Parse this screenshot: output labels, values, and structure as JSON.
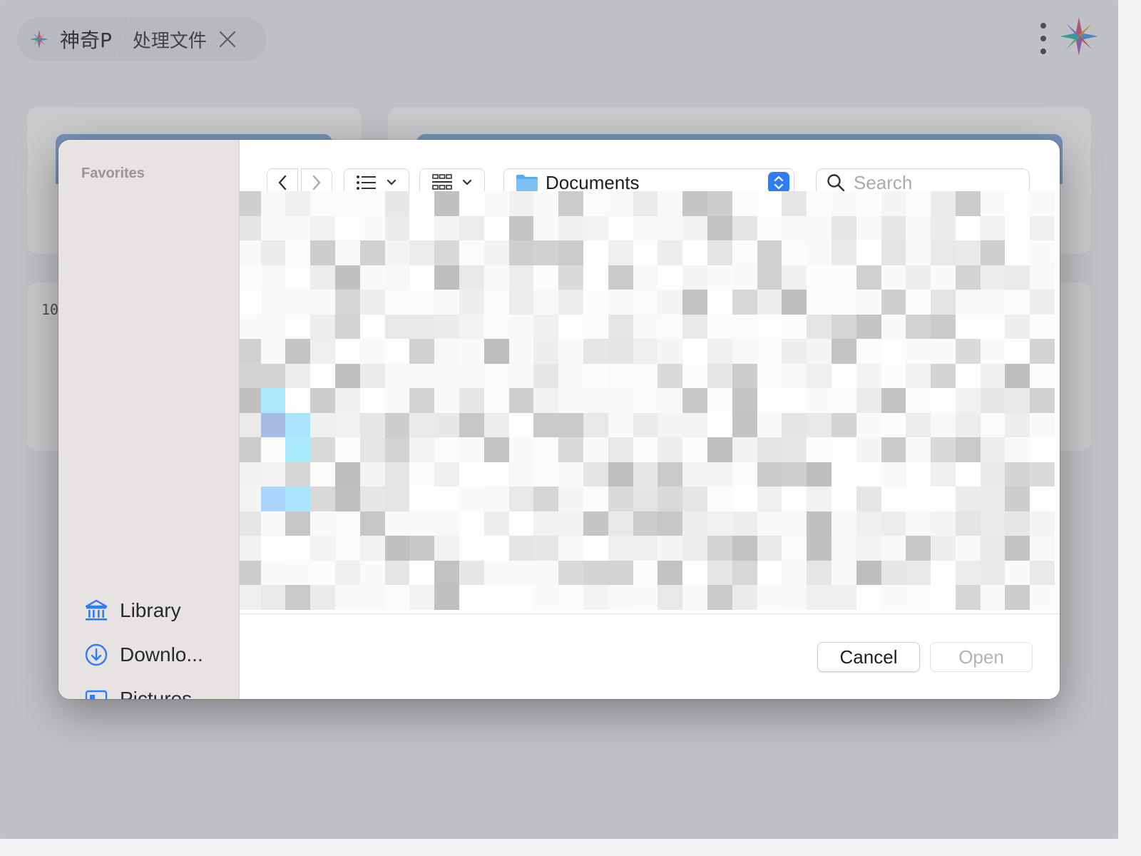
{
  "app": {
    "name": "神奇P",
    "tab_label": "处理文件",
    "bg_number": "10"
  },
  "dialog": {
    "sidebar": {
      "section_title": "Favorites",
      "items": [
        {
          "label": "Library",
          "icon": "library-icon"
        },
        {
          "label": "Downlo...",
          "icon": "downloads-icon"
        },
        {
          "label": "Pictures",
          "icon": "pictures-icon"
        }
      ]
    },
    "toolbar": {
      "location": "Documents",
      "search_placeholder": "Search"
    },
    "buttons": {
      "cancel": "Cancel",
      "open": "Open"
    }
  },
  "colors": {
    "accent": "#2f7cf6",
    "folder": "#5aa9ee",
    "sidebar_bg": "#e8e3e3"
  }
}
